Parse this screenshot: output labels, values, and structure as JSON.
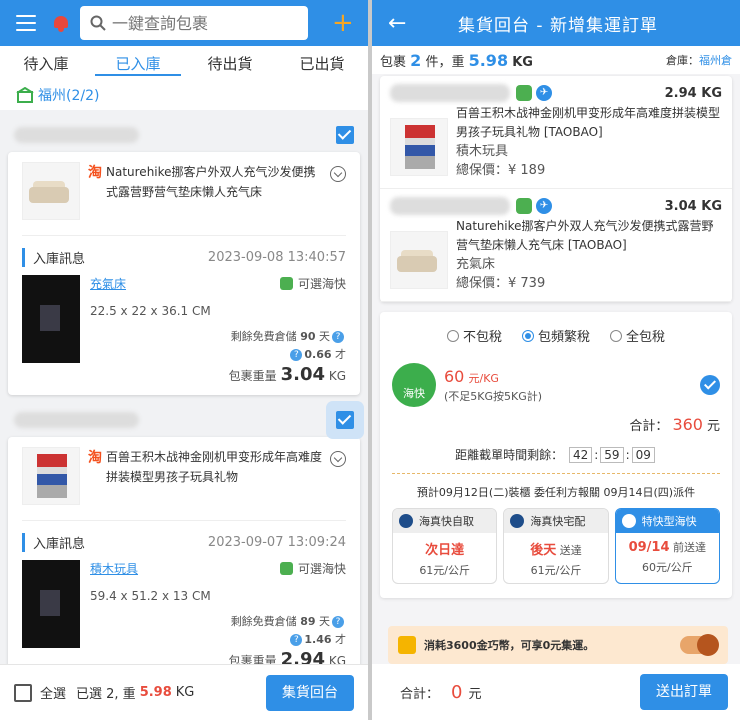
{
  "left": {
    "search_placeholder": "一鍵查詢包裹",
    "tabs": [
      {
        "label": "待入庫"
      },
      {
        "label": "已入庫"
      },
      {
        "label": "待出貨"
      },
      {
        "label": "已出貨"
      }
    ],
    "warehouse_label": "福州(2/2)",
    "packages": [
      {
        "product_name": "Naturehike挪客户外双人充气沙发便携式露营野营气垫床懒人充气床",
        "section_label": "入庫訊息",
        "date": "2023-09-08 13:40:57",
        "item_name": "充氣床",
        "shipping": "可選海快",
        "dimensions": "22.5 x 22 x 36.1 CM",
        "free_storage": "剩餘免費倉儲",
        "free_days": "90",
        "days_unit": "天",
        "volume": "0.66",
        "volume_unit": "才",
        "weight_label": "包裹重量",
        "weight": "3.04",
        "weight_unit": "KG"
      },
      {
        "product_name": "百兽王积木战神金刚机甲变形成年高难度拼装模型男孩子玩具礼物",
        "section_label": "入庫訊息",
        "date": "2023-09-07 13:09:24",
        "item_name": "積木玩具",
        "shipping": "可選海快",
        "dimensions": "59.4 x 51.2 x 13 CM",
        "free_storage": "剩餘免費倉儲",
        "free_days": "89",
        "days_unit": "天",
        "volume": "1.46",
        "volume_unit": "才",
        "weight_label": "包裹重量",
        "weight": "2.94",
        "weight_unit": "KG"
      }
    ],
    "bottom": {
      "select_all": "全選",
      "selected_text": "已選 2, 重",
      "selected_weight": "5.98",
      "weight_unit": "KG",
      "consolidate_button": "集貨回台"
    }
  },
  "right": {
    "title": "集貨回台 - 新增集運訂單",
    "summary": {
      "pkg_label": "包裹",
      "count": "2",
      "count_unit": "件，重",
      "weight": "5.98",
      "weight_unit": "KG",
      "warehouse_label": "倉庫：",
      "warehouse": "福州倉"
    },
    "items": [
      {
        "weight": "2.94 KG",
        "product_name": "百兽王积木战神金刚机甲变形成年高难度拼装模型男孩子玩具礼物 [TAOBAO]",
        "category": "積木玩具",
        "total": "總保價：¥ 189"
      },
      {
        "weight": "3.04 KG",
        "product_name": "Naturehike挪客户外双人充气沙发便携式露营野营气垫床懒人充气床 [TAOBAO]",
        "category": "充氣床",
        "total": "總保價：¥ 739"
      }
    ],
    "tax_options": [
      {
        "label": "不包稅",
        "selected": false
      },
      {
        "label": "包頻繁稅",
        "selected": true
      },
      {
        "label": "全包稅",
        "selected": false
      }
    ],
    "method": {
      "badge": "海快",
      "price": "60",
      "price_unit": "元/KG",
      "note": "(不足5KG按5KG計)",
      "total_label": "合計：",
      "total": "360",
      "total_unit": "元"
    },
    "countdown": {
      "label": "距離截單時間剩餘：",
      "h": "42",
      "m": "59",
      "s": "09"
    },
    "eta": "預計09月12日(二)裝櫃 委任利方報關 09月14日(四)派件",
    "delivery": [
      {
        "title": "海真快自取",
        "main": "次日達",
        "sub": "",
        "price": "61元/公斤",
        "selected": false
      },
      {
        "title": "海真快宅配",
        "main": "後天",
        "sub": "送達",
        "price": "61元/公斤",
        "selected": false
      },
      {
        "title": "特快型海快",
        "main": "09/14",
        "sub": "前送達",
        "price": "60元/公斤",
        "selected": true
      }
    ],
    "coin_text": "消耗3600金巧幣，可享0元集運。",
    "bottom": {
      "total_label": "合計：",
      "total": "0",
      "unit": "元",
      "submit": "送出訂單"
    }
  },
  "colors": {
    "primary": "#2f8fe6",
    "price": "#e84c3d",
    "sea": "#3cae4c"
  }
}
